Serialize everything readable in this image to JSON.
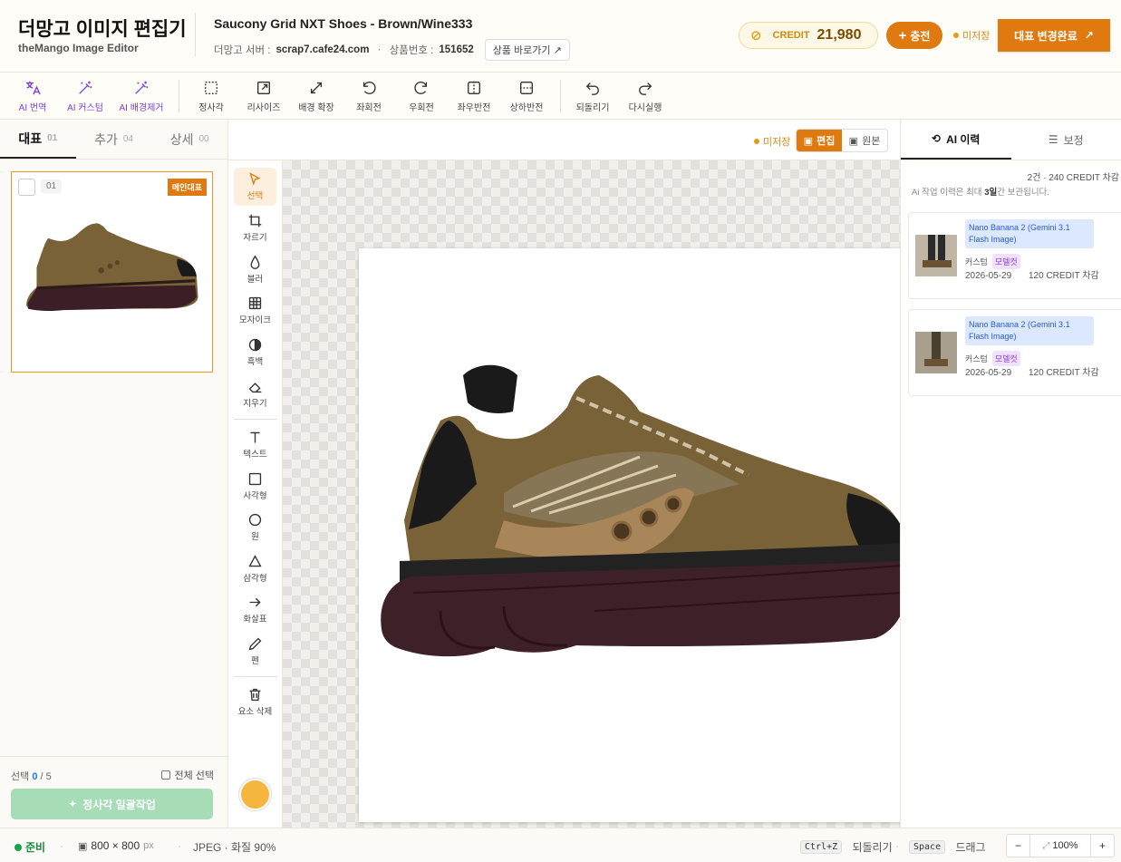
{
  "header": {
    "title": "더망고 이미지 편집기",
    "subtitle": "theMango Image Editor",
    "product_title": "Saucony Grid NXT Shoes - Brown/Wine333",
    "server_label": "더망고 서버 :",
    "server_value": "scrap7.cafe24.com",
    "product_no_label": "상품번호 :",
    "product_no_value": "151652",
    "product_link": "상품 바로가기",
    "credit_label": "CREDIT",
    "credit_value": "21,980",
    "charge_label": "충전",
    "unsaved_label": "미저장",
    "complete_label": "대표 변경완료"
  },
  "toolbar": {
    "ai_translate": "AI 번역",
    "ai_custom": "AI 커스텀",
    "ai_bg_remove": "AI 배경제거",
    "square": "정사각",
    "resize": "리사이즈",
    "bg_extend": "배경 확장",
    "rotate_left": "좌회전",
    "rotate_right": "우회전",
    "flip_h": "좌우반전",
    "flip_v": "상하반전",
    "undo": "되돌리기",
    "redo": "다시실행"
  },
  "left": {
    "tabs": [
      {
        "label": "대표",
        "count": "01"
      },
      {
        "label": "추가",
        "count": "04"
      },
      {
        "label": "상세",
        "count": "00"
      }
    ],
    "thumb_num": "01",
    "thumb_badge": "메인대표",
    "selected_label": "선택",
    "selected_count": "0",
    "selected_total": "/ 5",
    "select_all": "전체 선택",
    "batch_button": "정사각 일괄작업"
  },
  "center": {
    "unsaved_label": "미저장",
    "mode_edit": "편집",
    "mode_original": "원본",
    "tools": {
      "select": "선택",
      "crop": "자르기",
      "blur": "블러",
      "mosaic": "모자이크",
      "grayscale": "흑백",
      "erase": "지우기",
      "text": "텍스트",
      "rect": "사각형",
      "circle": "원",
      "triangle": "삼각형",
      "arrow": "화살표",
      "pen": "펜",
      "delete": "요소 삭제"
    },
    "color": "#f5b53e"
  },
  "right": {
    "tab_history": "AI 이력",
    "tab_adjust": "보정",
    "summary": "2건 · 240 CREDIT 차감",
    "note_prefix": "Ai 작업 이력은 최대",
    "note_days": "3일",
    "note_suffix": "간 보관됩니다.",
    "items": [
      {
        "model": "Nano Banana 2 (Gemini 3.1 Flash Image)",
        "tag1": "커스텀",
        "tag2": "모델컷",
        "date": "2026-05-29",
        "cost": "120 CREDIT 차감"
      },
      {
        "model": "Nano Banana 2 (Gemini 3.1 Flash Image)",
        "tag1": "커스텀",
        "tag2": "모델컷",
        "date": "2026-05-29",
        "cost": "120 CREDIT 차감"
      }
    ]
  },
  "status": {
    "ready": "준비",
    "size": "800 × 800",
    "size_unit": "px",
    "format": "JPEG · 화질 90%",
    "undo_key": "Ctrl+Z",
    "undo_label": "되돌리기",
    "drag_key": "Space",
    "drag_label": "드래그",
    "zoom": "100%",
    "zoom_minus": "−",
    "zoom_plus": "+"
  }
}
